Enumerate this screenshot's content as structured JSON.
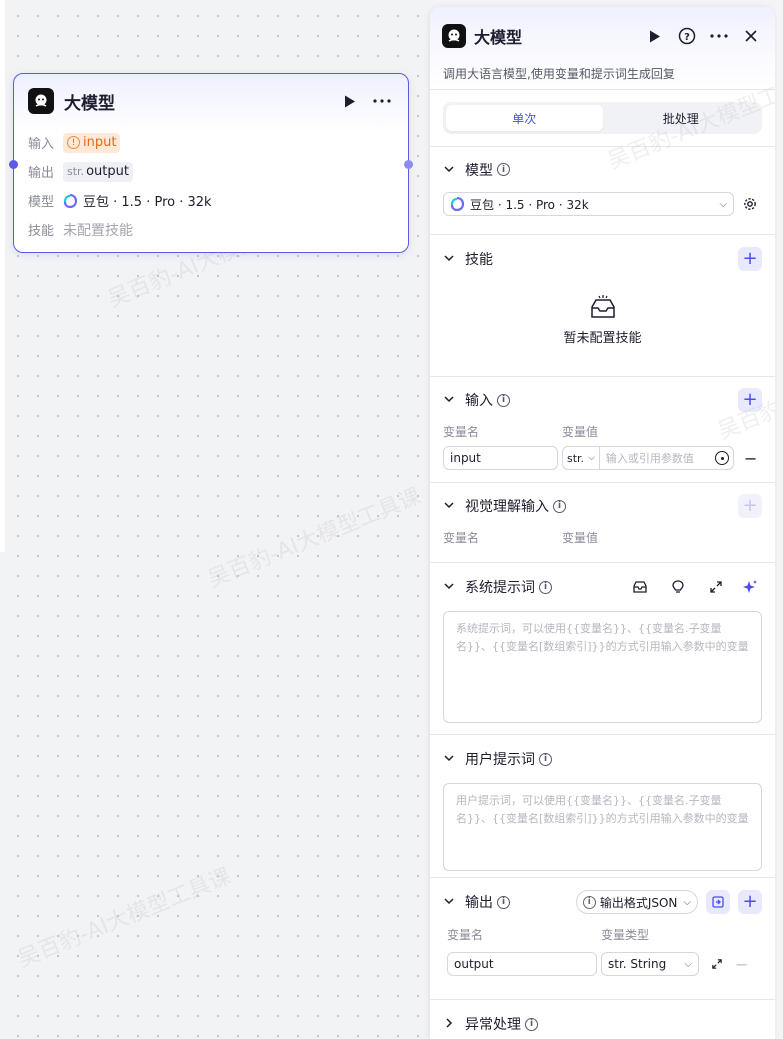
{
  "node": {
    "title": "大模型",
    "rows": {
      "input_key": "输入",
      "input_value": "input",
      "output_key": "输出",
      "output_prefix": "str.",
      "output_value": "output",
      "model_key": "模型",
      "model_value": "豆包 · 1.5 · Pro · 32k",
      "skill_key": "技能",
      "skill_value": "未配置技能"
    }
  },
  "panel": {
    "title": "大模型",
    "description": "调用大语言模型,使用变量和提示词生成回复",
    "tabs": [
      {
        "label": "单次",
        "active": true
      },
      {
        "label": "批处理",
        "active": false
      }
    ],
    "model": {
      "title": "模型",
      "selected": "豆包 · 1.5 · Pro · 32k"
    },
    "skills": {
      "title": "技能",
      "empty_text": "暂未配置技能"
    },
    "input": {
      "title": "输入",
      "col_name": "变量名",
      "col_value": "变量值",
      "row": {
        "name": "input",
        "type": "str.",
        "value_placeholder": "输入或引用参数值"
      }
    },
    "vision": {
      "title": "视觉理解输入",
      "col_name": "变量名",
      "col_value": "变量值"
    },
    "system_prompt": {
      "title": "系统提示词",
      "placeholder": "系统提示词，可以使用{{变量名}}、{{变量名.子变量名}}、{{变量名[数组索引]}}的方式引用输入参数中的变量"
    },
    "user_prompt": {
      "title": "用户提示词",
      "placeholder": "用户提示词，可以使用{{变量名}}、{{变量名.子变量名}}、{{变量名[数组索引]}}的方式引用输入参数中的变量"
    },
    "output": {
      "title": "输出",
      "format_button": "输出格式JSON",
      "col_name": "变量名",
      "col_type": "变量类型",
      "row": {
        "name": "output",
        "type": "str. String"
      }
    },
    "exception": {
      "title": "异常处理"
    }
  },
  "watermark": "吴百豹-AI大模型工具课",
  "colors": {
    "accent": "#4c4de6",
    "node_border": "#5a5ae8",
    "warning": "#e26a1c"
  }
}
